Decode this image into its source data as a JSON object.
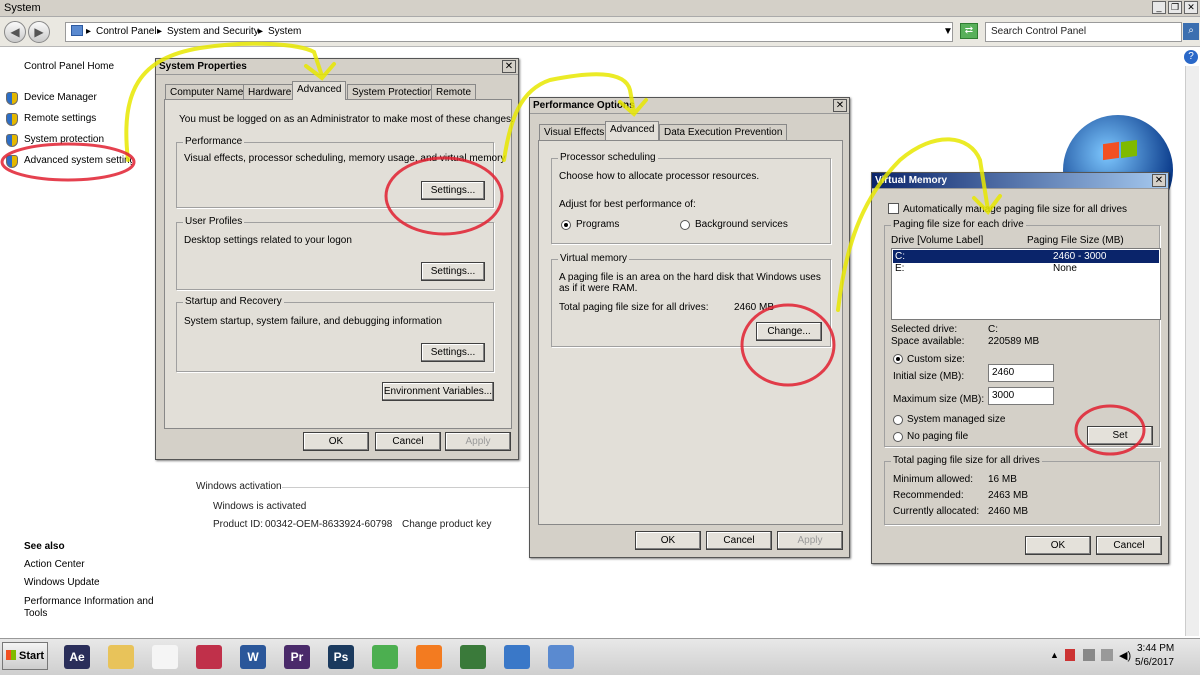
{
  "window": {
    "title": "System"
  },
  "address": {
    "crumbs": [
      "Control Panel",
      "System and Security",
      "System"
    ],
    "search_placeholder": "Search Control Panel"
  },
  "sidebar": {
    "home": "Control Panel Home",
    "items": [
      {
        "label": "Device Manager",
        "icon": "shield-icon"
      },
      {
        "label": "Remote settings",
        "icon": "shield-icon"
      },
      {
        "label": "System protection",
        "icon": "shield-icon"
      },
      {
        "label": "Advanced system settings",
        "icon": "shield-icon"
      }
    ],
    "see_also_title": "See also",
    "see_also": [
      "Action Center",
      "Windows Update",
      "Performance Information and Tools"
    ]
  },
  "main": {
    "activation_title": "Windows activation",
    "activated": "Windows is activated",
    "product_id_label": "Product ID:",
    "product_id": "00342-OEM-8633924-60798",
    "change_key": "Change product key"
  },
  "sysprops": {
    "title": "System Properties",
    "tabs": [
      "Computer Name",
      "Hardware",
      "Advanced",
      "System Protection",
      "Remote"
    ],
    "notice": "You must be logged on as an Administrator to make most of these changes.",
    "performance": {
      "label": "Performance",
      "desc": "Visual effects, processor scheduling, memory usage, and virtual memory",
      "button": "Settings..."
    },
    "profiles": {
      "label": "User Profiles",
      "desc": "Desktop settings related to your logon",
      "button": "Settings..."
    },
    "startup": {
      "label": "Startup and Recovery",
      "desc": "System startup, system failure, and debugging information",
      "button": "Settings..."
    },
    "env_button": "Environment Variables...",
    "ok": "OK",
    "cancel": "Cancel",
    "apply": "Apply"
  },
  "perfopts": {
    "title": "Performance Options",
    "tabs": [
      "Visual Effects",
      "Advanced",
      "Data Execution Prevention"
    ],
    "sched_label": "Processor scheduling",
    "sched_desc": "Choose how to allocate processor resources.",
    "adjust": "Adjust for best performance of:",
    "programs": "Programs",
    "background": "Background services",
    "vm_label": "Virtual memory",
    "vm_desc": "A paging file is an area on the hard disk that Windows uses as if it were RAM.",
    "total_label": "Total paging file size for all drives:",
    "total_value": "2460 MB",
    "change": "Change...",
    "ok": "OK",
    "cancel": "Cancel",
    "apply": "Apply"
  },
  "vmem": {
    "title": "Virtual Memory",
    "auto_manage": "Automatically manage paging file size for all drives",
    "group_label": "Paging file size for each drive",
    "col_drive": "Drive  [Volume Label]",
    "col_size": "Paging File Size (MB)",
    "rows": [
      {
        "drive": "C:",
        "size": "2460 - 3000"
      },
      {
        "drive": "E:",
        "size": "None"
      }
    ],
    "selected_label": "Selected drive:",
    "selected_value": "C:",
    "space_label": "Space available:",
    "space_value": "220589 MB",
    "custom": "Custom size:",
    "initial_label": "Initial size (MB):",
    "initial_value": "2460",
    "max_label": "Maximum size (MB):",
    "max_value": "3000",
    "system_managed": "System managed size",
    "no_paging": "No paging file",
    "set": "Set",
    "totals_label": "Total paging file size for all drives",
    "min_label": "Minimum allowed:",
    "min_value": "16 MB",
    "rec_label": "Recommended:",
    "rec_value": "2463 MB",
    "cur_label": "Currently allocated:",
    "cur_value": "2460 MB",
    "ok": "OK",
    "cancel": "Cancel"
  },
  "taskbar": {
    "start": "Start",
    "apps": [
      {
        "name": "after-effects-icon",
        "label": "Ae",
        "color": "#2a2e5a"
      },
      {
        "name": "folder-icon",
        "label": "",
        "color": "#e8c35a"
      },
      {
        "name": "acrobat-icon",
        "label": "",
        "color": "#f5f5f5"
      },
      {
        "name": "acrobat-pro-icon",
        "label": "",
        "color": "#c0304a"
      },
      {
        "name": "word-icon",
        "label": "W",
        "color": "#2b579a"
      },
      {
        "name": "premiere-icon",
        "label": "Pr",
        "color": "#4a2a6a"
      },
      {
        "name": "photoshop-icon",
        "label": "Ps",
        "color": "#1b3a5e"
      },
      {
        "name": "chrome-icon",
        "label": "",
        "color": "#4caf50"
      },
      {
        "name": "xampp-icon",
        "label": "",
        "color": "#f37b20"
      },
      {
        "name": "task-manager-icon",
        "label": "",
        "color": "#3a7a3a"
      },
      {
        "name": "control-panel-icon",
        "label": "",
        "color": "#3a78c8"
      },
      {
        "name": "system-window-icon",
        "label": "",
        "color": "#5a8ad0"
      }
    ],
    "time": "3:44 PM",
    "date": "5/6/2017"
  }
}
